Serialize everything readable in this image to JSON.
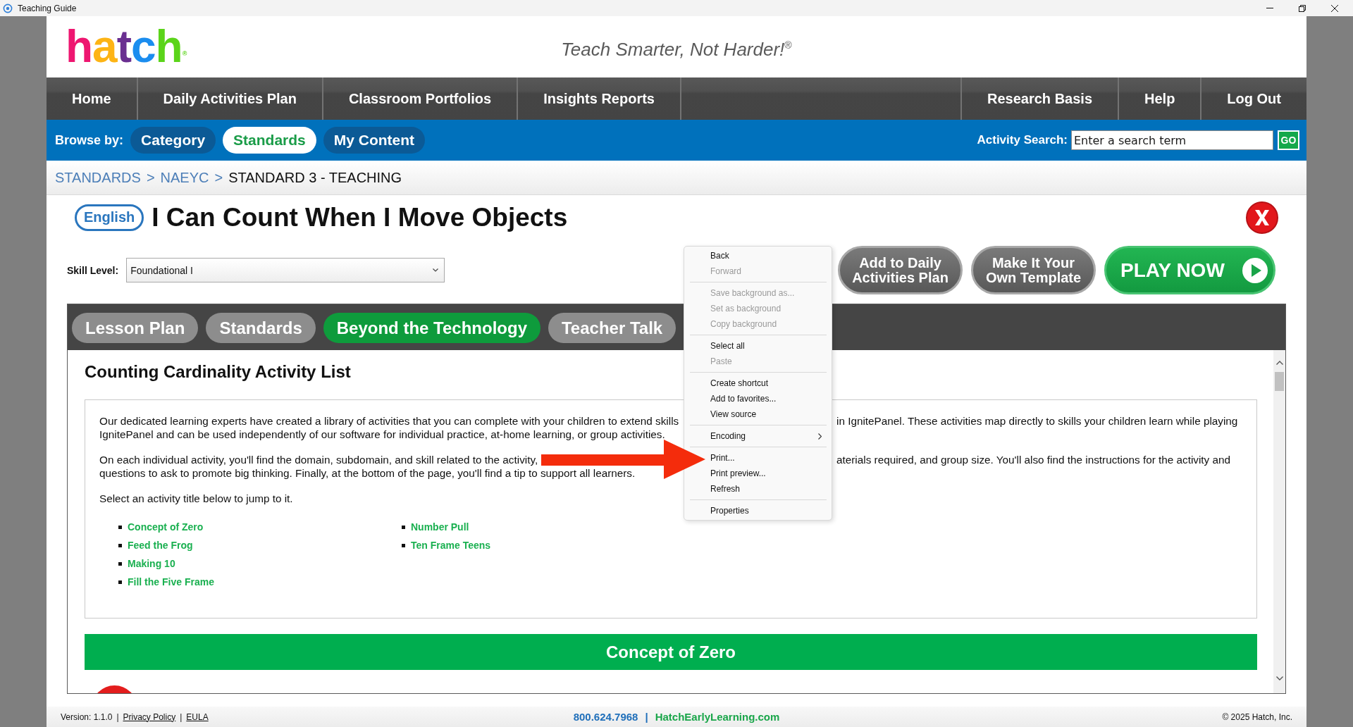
{
  "window": {
    "title": "Teaching Guide"
  },
  "header": {
    "logo": {
      "letters": [
        {
          "char": "h",
          "color": "#ee1670"
        },
        {
          "char": "a",
          "color": "#fdb415"
        },
        {
          "char": "t",
          "color": "#6a2f90"
        },
        {
          "char": "c",
          "color": "#1b8def"
        },
        {
          "char": "h",
          "color": "#5bd41a"
        }
      ],
      "mark": "®"
    },
    "tagline": "Teach Smarter, Not Harder!$^{®}$"
  },
  "nav": {
    "left": [
      "Home",
      "Daily Activities Plan",
      "Classroom Portfolios",
      "Insights Reports"
    ],
    "right": [
      "Research Basis",
      "Help",
      "Log Out"
    ]
  },
  "browse": {
    "label": "Browse by:",
    "options": [
      {
        "label": "Category",
        "selected": false
      },
      {
        "label": "Standards",
        "selected": true
      },
      {
        "label": "My Content",
        "selected": false
      }
    ],
    "search": {
      "label": "Activity Search:",
      "placeholder": "Enter a search term",
      "button": "GO"
    }
  },
  "breadcrumb": [
    {
      "kind": "link",
      "label": "STANDARDS"
    },
    {
      "kind": "separator",
      "label": ">"
    },
    {
      "kind": "link",
      "label": "NAEYC"
    },
    {
      "kind": "separator",
      "label": ">"
    },
    {
      "kind": "current",
      "label": "STANDARD 3 - TEACHING"
    }
  ],
  "activity": {
    "language": "English",
    "title": "I Can Count When I Move Objects",
    "skill_level": {
      "label": "Skill Level:",
      "value": "Foundational I"
    },
    "actions": [
      {
        "kind": "secondary",
        "label": "Add to Daily Activities Plan"
      },
      {
        "kind": "secondary",
        "label": "Make It Your Own Template"
      },
      {
        "kind": "play",
        "label": "PLAY NOW"
      }
    ]
  },
  "tabs": [
    {
      "label": "Lesson Plan",
      "selected": false
    },
    {
      "label": "Standards",
      "selected": false
    },
    {
      "label": "Beyond the Technology",
      "selected": true
    },
    {
      "label": "Teacher Talk",
      "selected": false
    }
  ],
  "content": {
    "heading": "Counting Cardinality Activity List",
    "paragraphs": [
      {
        "lines": [
          "Our dedicated learning experts have created a library of activities that you can complete with your children to extend skills",
          "IgnitePanel and can be used independently of our software for individual practice, at-home learning, or group activities."
        ],
        "right_lines": [
          "in IgnitePanel. These activities map directly to skills your children learn while playing"
        ]
      },
      {
        "lines": [
          "On each individual activity, you'll find the domain, subdomain, and skill related to the activity,",
          "questions to ask to promote big thinking. Finally, at the bottom of the page, you'll find a tip to support all learners."
        ],
        "right_lines": [
          "aterials required, and group size. You'll also find the instructions for the activity and"
        ]
      },
      {
        "lines": [
          "Select an activity title below to jump to it."
        ]
      }
    ],
    "link_columns": [
      [
        "Concept of Zero",
        "Feed the Frog",
        "Making 10",
        "Fill the Five Frame"
      ],
      [
        "Number Pull",
        "Ten Frame Teens"
      ]
    ],
    "section": {
      "title": "Concept of Zero"
    }
  },
  "context_menu": {
    "groups": [
      [
        {
          "label": "Back",
          "disabled": false,
          "submenu": false
        },
        {
          "label": "Forward",
          "disabled": true,
          "submenu": false
        }
      ],
      [
        {
          "label": "Save background as...",
          "disabled": true,
          "submenu": false
        },
        {
          "label": "Set as background",
          "disabled": true,
          "submenu": false
        },
        {
          "label": "Copy background",
          "disabled": true,
          "submenu": false
        }
      ],
      [
        {
          "label": "Select all",
          "disabled": false,
          "submenu": false
        },
        {
          "label": "Paste",
          "disabled": true,
          "submenu": false
        }
      ],
      [
        {
          "label": "Create shortcut",
          "disabled": false,
          "submenu": false
        },
        {
          "label": "Add to favorites...",
          "disabled": false,
          "submenu": false
        },
        {
          "label": "View source",
          "disabled": false,
          "submenu": false
        }
      ],
      [
        {
          "label": "Encoding",
          "disabled": false,
          "submenu": true
        }
      ],
      [
        {
          "label": "Print...",
          "disabled": false,
          "submenu": false
        },
        {
          "label": "Print preview...",
          "disabled": false,
          "submenu": false
        },
        {
          "label": "Refresh",
          "disabled": false,
          "submenu": false
        }
      ],
      [
        {
          "label": "Properties",
          "disabled": false,
          "submenu": false
        }
      ]
    ]
  },
  "footer": {
    "left": [
      {
        "kind": "text",
        "label": "Version: 1.1.0"
      },
      {
        "kind": "separator",
        "label": "|"
      },
      {
        "kind": "link",
        "label": "Privacy Policy"
      },
      {
        "kind": "separator",
        "label": "|"
      },
      {
        "kind": "link",
        "label": "EULA"
      }
    ],
    "center": [
      {
        "kind": "phone",
        "label": "800.624.7968"
      },
      {
        "kind": "separator",
        "label": "|"
      },
      {
        "kind": "web",
        "label": "HatchEarlyLearning.com"
      }
    ],
    "right": "© 2025 Hatch, Inc."
  }
}
